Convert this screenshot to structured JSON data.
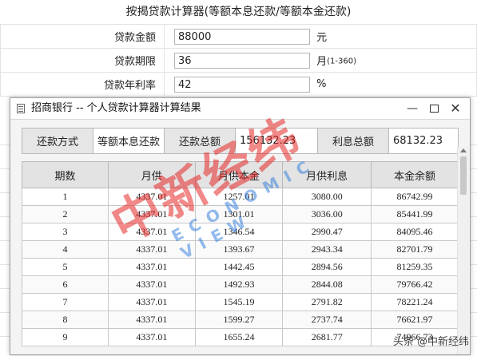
{
  "calculator": {
    "title": "按揭贷款计算器(等额本息还款/等额本金还款)",
    "amount_label": "贷款金额",
    "amount_value": "88000",
    "amount_unit": "元",
    "term_label": "贷款期限",
    "term_value": "36",
    "term_unit": "月",
    "term_hint": "(1-360)",
    "rate_label": "贷款年利率",
    "rate_value": "42",
    "rate_unit": "%"
  },
  "dialog": {
    "title": "招商银行 -- 个人贷款计算器计算结果",
    "minimize": "—",
    "close": "✕",
    "summary": {
      "method_label": "还款方式",
      "method_value": "等额本息还款",
      "total_label": "还款总额",
      "total_value": "156132.23",
      "interest_label": "利息总额",
      "interest_value": "68132.23"
    },
    "columns": [
      "期数",
      "月供",
      "月供本金",
      "月供利息",
      "本金余额"
    ],
    "rows": [
      [
        "1",
        "4337.01",
        "1257.01",
        "3080.00",
        "86742.99"
      ],
      [
        "2",
        "4337.01",
        "1301.01",
        "3036.00",
        "85441.99"
      ],
      [
        "3",
        "4337.01",
        "1346.54",
        "2990.47",
        "84095.46"
      ],
      [
        "4",
        "4337.01",
        "1393.67",
        "2943.34",
        "82701.79"
      ],
      [
        "5",
        "4337.01",
        "1442.45",
        "2894.56",
        "81259.35"
      ],
      [
        "6",
        "4337.01",
        "1492.93",
        "2844.08",
        "79766.42"
      ],
      [
        "7",
        "4337.01",
        "1545.19",
        "2791.82",
        "78221.24"
      ],
      [
        "8",
        "4337.01",
        "1599.27",
        "2737.74",
        "76621.97"
      ],
      [
        "9",
        "4337.01",
        "1655.24",
        "2681.77",
        "74966.73"
      ]
    ]
  },
  "watermark": {
    "main": "中新经纬",
    "sub": "ECONOMIC VIEW"
  },
  "credit": "头条 @中新经纬",
  "icons": {
    "app": "window-app-icon",
    "scroll_up": "scroll-up-arrow-icon"
  }
}
